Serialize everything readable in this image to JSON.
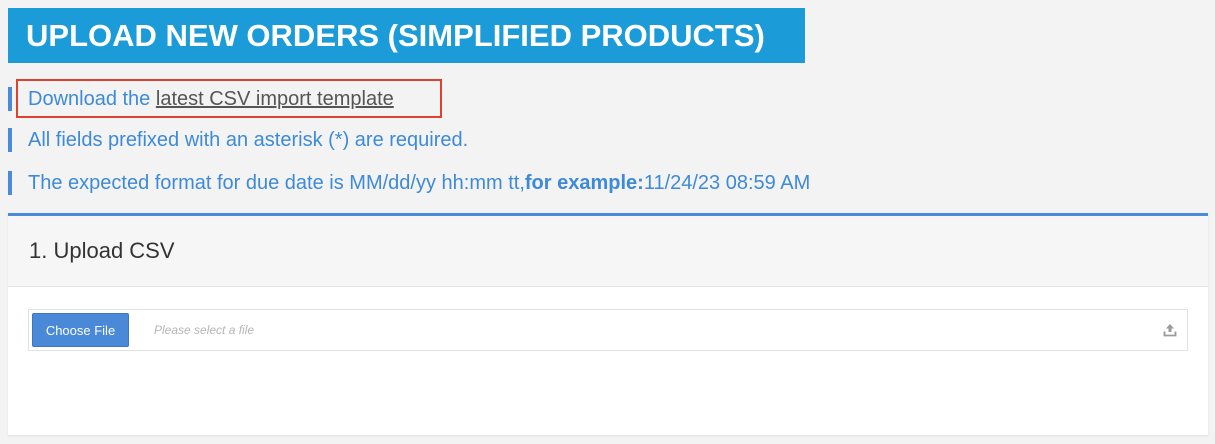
{
  "header": {
    "title": "UPLOAD NEW ORDERS (SIMPLIFIED PRODUCTS)"
  },
  "info": {
    "download_prefix": "Download the ",
    "download_link": "latest CSV import template",
    "required_note": "All fields prefixed with an asterisk (*) are required.",
    "date_format_prefix": "The expected format for due date is MM/dd/yy hh:mm tt, ",
    "date_example_label": "for example:",
    "date_example_value": " 11/24/23 08:59 AM"
  },
  "upload_panel": {
    "step_title": "1. Upload CSV",
    "choose_file_label": "Choose File",
    "file_placeholder": "Please select a file",
    "upload_icon": "upload-icon"
  },
  "colors": {
    "banner": "#1b9bd8",
    "accent_blue": "#4a8ad9",
    "info_text": "#3d8ad9",
    "highlight_border": "#e0402e",
    "button": "#4a88d8"
  }
}
